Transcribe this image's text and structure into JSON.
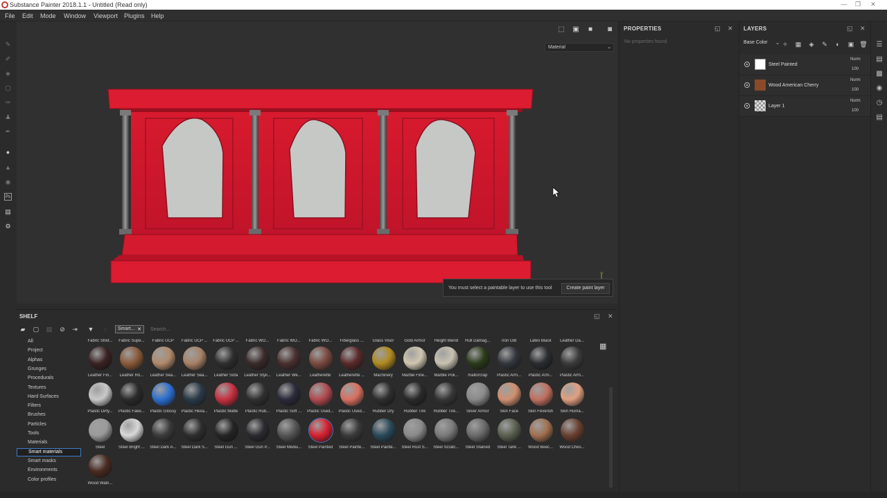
{
  "window": {
    "title": "Substance Painter 2018.1.1 - Untitled (Read only)",
    "controls": [
      "—",
      "❐",
      "✕"
    ]
  },
  "menu": [
    "File",
    "Edit",
    "Mode",
    "Window",
    "Viewport",
    "Plugins",
    "Help"
  ],
  "viewport": {
    "material_select": "Material",
    "toast_message": "You must select a paintable layer to use this tool",
    "toast_button": "Create paint layer",
    "axis_label": "Y"
  },
  "properties": {
    "title": "PROPERTIES",
    "empty_text": "No properties found"
  },
  "layers": {
    "title": "LAYERS",
    "channel": "Base Color",
    "items": [
      {
        "name": "Steel Painted",
        "blend": "Norm",
        "opacity": "100",
        "thumb": "#ffffff"
      },
      {
        "name": "Wood American Cherry",
        "blend": "Norm",
        "opacity": "100",
        "thumb": "#8a4a2a"
      },
      {
        "name": "Layer 1",
        "blend": "Norm",
        "opacity": "100",
        "thumb": "checker"
      }
    ]
  },
  "shelf": {
    "title": "SHELF",
    "tag": "Smart...",
    "search_placeholder": "Search...",
    "categories": [
      "All",
      "Project",
      "Alphas",
      "Grunges",
      "Procedurals",
      "Textures",
      "Hard Surfaces",
      "Filters",
      "Brushes",
      "Particles",
      "Tools",
      "Materials",
      "Smart materials",
      "Smart masks",
      "Environments",
      "Color profiles"
    ],
    "selected_category": "Smart materials",
    "top_labels": [
      "Fabric Stret...",
      "Fabric Supe...",
      "Fabric UCP",
      "Fabric UCP ...",
      "Fabric UCP ...",
      "Fabric WO...",
      "Fabric WO...",
      "Fabric WO...",
      "Fiberglass ...",
      "Glass Visor",
      "Gold Armor",
      "Height Blend",
      "Hull Damag...",
      "Iron Old",
      "Latex Black",
      "Leather Da..."
    ],
    "rows": [
      [
        {
          "label": "Leather Fin...",
          "color": "#3a2222"
        },
        {
          "label": "Leather Ro...",
          "color": "#8a5a3a"
        },
        {
          "label": "Leather Sea...",
          "color": "#b08a6a"
        },
        {
          "label": "Leather Sea...",
          "color": "#a88266"
        },
        {
          "label": "Leather Sofa",
          "color": "#2e2e2e"
        },
        {
          "label": "Leather Styli...",
          "color": "#3a2a2a"
        },
        {
          "label": "Leather We...",
          "color": "#4a3030"
        },
        {
          "label": "Leatherette",
          "color": "#7a4a40"
        },
        {
          "label": "Leatherette ...",
          "color": "#5a2a2a"
        },
        {
          "label": "Machinery",
          "color": "#b08a20"
        },
        {
          "label": "Marble Fine...",
          "color": "#cfc6b0"
        },
        {
          "label": "Marble Poli...",
          "color": "#c8c2b0"
        },
        {
          "label": "mallorcrap",
          "color": "#2a3a1a"
        },
        {
          "label": "Plastic Arm...",
          "color": "#33363c"
        },
        {
          "label": "Plastic Arm...",
          "color": "#2a2c30"
        },
        {
          "label": "Plastic Arm...",
          "color": "#3a3a3a"
        }
      ],
      [
        {
          "label": "Plastic Dirty...",
          "color": "#c8c8c8"
        },
        {
          "label": "Plastic Fake...",
          "color": "#2a2a2a"
        },
        {
          "label": "Plastic Glossy",
          "color": "#2c6fd0"
        },
        {
          "label": "Plastic Hexa...",
          "color": "#2a3a48"
        },
        {
          "label": "Plastic Matte",
          "color": "#c83040"
        },
        {
          "label": "Plastic Rub...",
          "color": "#303030"
        },
        {
          "label": "Plastic Soft ...",
          "color": "#2a2a3a"
        },
        {
          "label": "Plastic Used...",
          "color": "#b04a50"
        },
        {
          "label": "Plastic Used...",
          "color": "#d87060"
        },
        {
          "label": "Rubber Dry",
          "color": "#2e2e2e"
        },
        {
          "label": "Rubber Tire",
          "color": "#2a2a2a"
        },
        {
          "label": "Rubber Tire...",
          "color": "#363636"
        },
        {
          "label": "Silver Armor",
          "color": "#8a8a8a"
        },
        {
          "label": "Skin Face",
          "color": "#d09070"
        },
        {
          "label": "Skin Feverish",
          "color": "#c07060"
        },
        {
          "label": "Skin Huma...",
          "color": "#e0a080"
        }
      ],
      [
        {
          "label": "Steel",
          "color": "#9a9a9a"
        },
        {
          "label": "Steel Bright ...",
          "color": "#d8d8d8"
        },
        {
          "label": "Steel Dark A...",
          "color": "#3a3a3a"
        },
        {
          "label": "Steel Dark S...",
          "color": "#2e2e2e"
        },
        {
          "label": "Steel Gun ...",
          "color": "#252525"
        },
        {
          "label": "Steel Gun P...",
          "color": "#2a2a30"
        },
        {
          "label": "Steel Mediu...",
          "color": "#555555"
        },
        {
          "label": "Steel Painted",
          "color": "#d82030"
        },
        {
          "label": "Steel Painte...",
          "color": "#3a3a3a"
        },
        {
          "label": "Steel Painte...",
          "color": "#2a4a5a"
        },
        {
          "label": "Steel Rust S...",
          "color": "#8a8a8a"
        },
        {
          "label": "Steel Scratc...",
          "color": "#7a7a7a"
        },
        {
          "label": "Steel Stained",
          "color": "#6a6a6a"
        },
        {
          "label": "Steel Tank ...",
          "color": "#5a6050"
        },
        {
          "label": "Wood Beec...",
          "color": "#a07050"
        },
        {
          "label": "Wood Ches...",
          "color": "#6a4030"
        }
      ],
      [
        {
          "label": "Wood Waln...",
          "color": "#4a2a20"
        }
      ]
    ],
    "selected_item": "Steel Painted"
  },
  "colors": {
    "accent": "#3d7cc9",
    "paint_red": "#d0182c"
  }
}
